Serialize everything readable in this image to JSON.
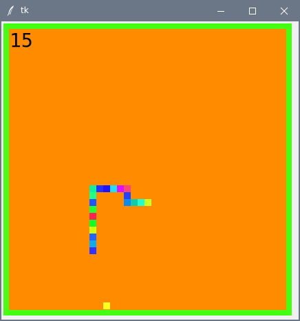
{
  "window": {
    "title": "tk",
    "icons": {
      "app": "feather-icon",
      "minimize": "minimize-icon",
      "maximize": "maximize-icon",
      "close": "close-icon"
    }
  },
  "game": {
    "score": "15",
    "colors": {
      "border": "#44ff11",
      "field": "#ff8c00",
      "food": "#ffff22"
    },
    "grid_cell_units": 10,
    "snake": [
      {
        "col": 20,
        "row": 25,
        "color": "#ccff22"
      },
      {
        "col": 19,
        "row": 25,
        "color": "#22ffcc"
      },
      {
        "col": 18,
        "row": 25,
        "color": "#11ccaa"
      },
      {
        "col": 17,
        "row": 25,
        "color": "#1188ee"
      },
      {
        "col": 17,
        "row": 24,
        "color": "#2244ff"
      },
      {
        "col": 17,
        "row": 23,
        "color": "#ff4477"
      },
      {
        "col": 16,
        "row": 23,
        "color": "#dd11ff"
      },
      {
        "col": 15,
        "row": 23,
        "color": "#22ddff"
      },
      {
        "col": 14,
        "row": 23,
        "color": "#2211ff"
      },
      {
        "col": 13,
        "row": 23,
        "color": "#2233ff"
      },
      {
        "col": 12,
        "row": 23,
        "color": "#11ee99"
      },
      {
        "col": 12,
        "row": 24,
        "color": "#22ff88"
      },
      {
        "col": 12,
        "row": 25,
        "color": "#2255ff"
      },
      {
        "col": 12,
        "row": 26,
        "color": "#22ff33"
      },
      {
        "col": 12,
        "row": 27,
        "color": "#ff2255"
      },
      {
        "col": 12,
        "row": 28,
        "color": "#11ff22"
      },
      {
        "col": 12,
        "row": 29,
        "color": "#ccff11"
      },
      {
        "col": 12,
        "row": 30,
        "color": "#2266ff"
      },
      {
        "col": 12,
        "row": 31,
        "color": "#11aaee"
      },
      {
        "col": 12,
        "row": 32,
        "color": "#3333ff"
      }
    ],
    "food": {
      "col": 14,
      "row": 40
    }
  }
}
